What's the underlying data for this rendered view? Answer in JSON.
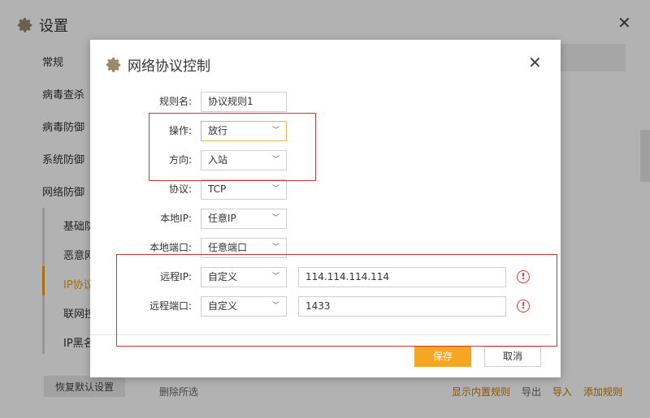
{
  "background": {
    "title": "设置",
    "nav": [
      "常规",
      "病毒查杀",
      "病毒防御",
      "系统防御",
      "网络防御"
    ],
    "sub_nav": [
      "基础防",
      "恶意网",
      "IP协议",
      "联网控",
      "IP黑名"
    ],
    "restore_label": "恢复默认设置",
    "delete_label": "删除所选",
    "actions": {
      "show_builtin": "显示内置规则",
      "export": "导出",
      "import": "导入",
      "add_rule": "添加规则"
    }
  },
  "dialog": {
    "title": "网络协议控制",
    "fields": {
      "rule_name": {
        "label": "规则名:",
        "value": "协议规则1"
      },
      "operation": {
        "label": "操作:",
        "value": "放行"
      },
      "direction": {
        "label": "方向:",
        "value": "入站"
      },
      "protocol": {
        "label": "协议:",
        "value": "TCP"
      },
      "local_ip": {
        "label": "本地IP:",
        "value": "任意IP"
      },
      "local_port": {
        "label": "本地端口:",
        "value": "任意端口"
      },
      "remote_ip": {
        "label": "远程IP:",
        "value": "自定义",
        "input": "114.114.114.114"
      },
      "remote_port": {
        "label": "远程端口:",
        "value": "自定义",
        "input": "1433"
      }
    },
    "save_label": "保存",
    "cancel_label": "取消"
  },
  "colors": {
    "accent": "#f5a623",
    "highlight_box": "#d93030",
    "warning": "#e53935"
  }
}
